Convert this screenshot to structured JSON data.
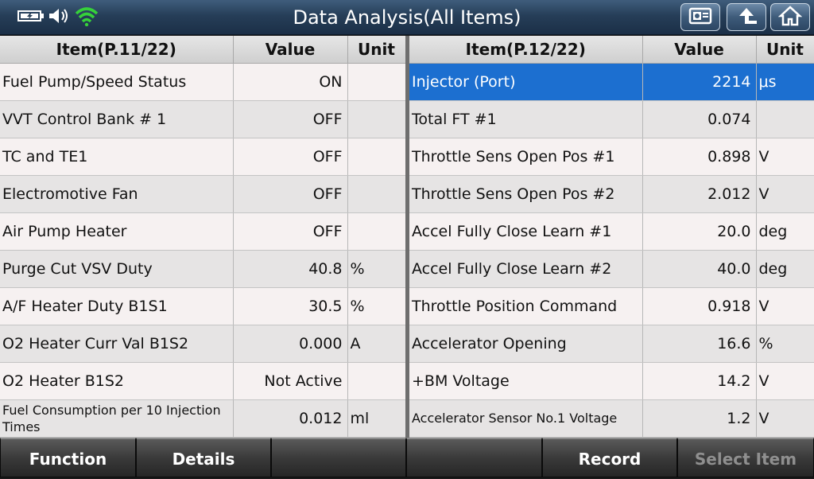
{
  "title": "Data Analysis(All Items)",
  "status_icons": [
    "battery-icon",
    "speaker-icon",
    "wifi-icon"
  ],
  "top_buttons": [
    "screenshot-icon",
    "back-icon",
    "home-icon"
  ],
  "left": {
    "headers": {
      "item": "Item(P.11/22)",
      "value": "Value",
      "unit": "Unit"
    },
    "rows": [
      {
        "item": "Fuel Pump/Speed Status",
        "value": "ON",
        "unit": ""
      },
      {
        "item": "VVT Control Bank # 1",
        "value": "OFF",
        "unit": ""
      },
      {
        "item": "TC and TE1",
        "value": "OFF",
        "unit": ""
      },
      {
        "item": "Electromotive Fan",
        "value": "OFF",
        "unit": ""
      },
      {
        "item": "Air Pump Heater",
        "value": "OFF",
        "unit": ""
      },
      {
        "item": "Purge Cut VSV Duty",
        "value": "40.8",
        "unit": "%"
      },
      {
        "item": "A/F Heater Duty B1S1",
        "value": "30.5",
        "unit": "%"
      },
      {
        "item": "O2 Heater Curr Val B1S2",
        "value": "0.000",
        "unit": "A"
      },
      {
        "item": "O2 Heater B1S2",
        "value": "Not Active",
        "unit": ""
      },
      {
        "item": "Fuel Consumption per 10 Injection Times",
        "value": "0.012",
        "unit": "ml"
      }
    ]
  },
  "right": {
    "headers": {
      "item": "Item(P.12/22)",
      "value": "Value",
      "unit": "Unit"
    },
    "rows": [
      {
        "item": "Injector (Port)",
        "value": "2214",
        "unit": "μs"
      },
      {
        "item": "Total FT #1",
        "value": "0.074",
        "unit": ""
      },
      {
        "item": "Throttle Sens Open Pos #1",
        "value": "0.898",
        "unit": "V"
      },
      {
        "item": "Throttle Sens Open Pos #2",
        "value": "2.012",
        "unit": "V"
      },
      {
        "item": "Accel Fully Close Learn #1",
        "value": "20.0",
        "unit": "deg"
      },
      {
        "item": "Accel Fully Close Learn #2",
        "value": "40.0",
        "unit": "deg"
      },
      {
        "item": "Throttle Position Command",
        "value": "0.918",
        "unit": "V"
      },
      {
        "item": "Accelerator Opening",
        "value": "16.6",
        "unit": "%"
      },
      {
        "item": "+BM Voltage",
        "value": "14.2",
        "unit": "V"
      },
      {
        "item": "Accelerator Sensor No.1 Voltage",
        "value": "1.2",
        "unit": "V"
      }
    ]
  },
  "bottom": {
    "function": "Function",
    "details": "Details",
    "blank1": "",
    "blank2": "",
    "record": "Record",
    "select_item": "Select Item"
  },
  "colors": {
    "selected_row": "#1c6fd0",
    "titlebar": "#263e58"
  }
}
